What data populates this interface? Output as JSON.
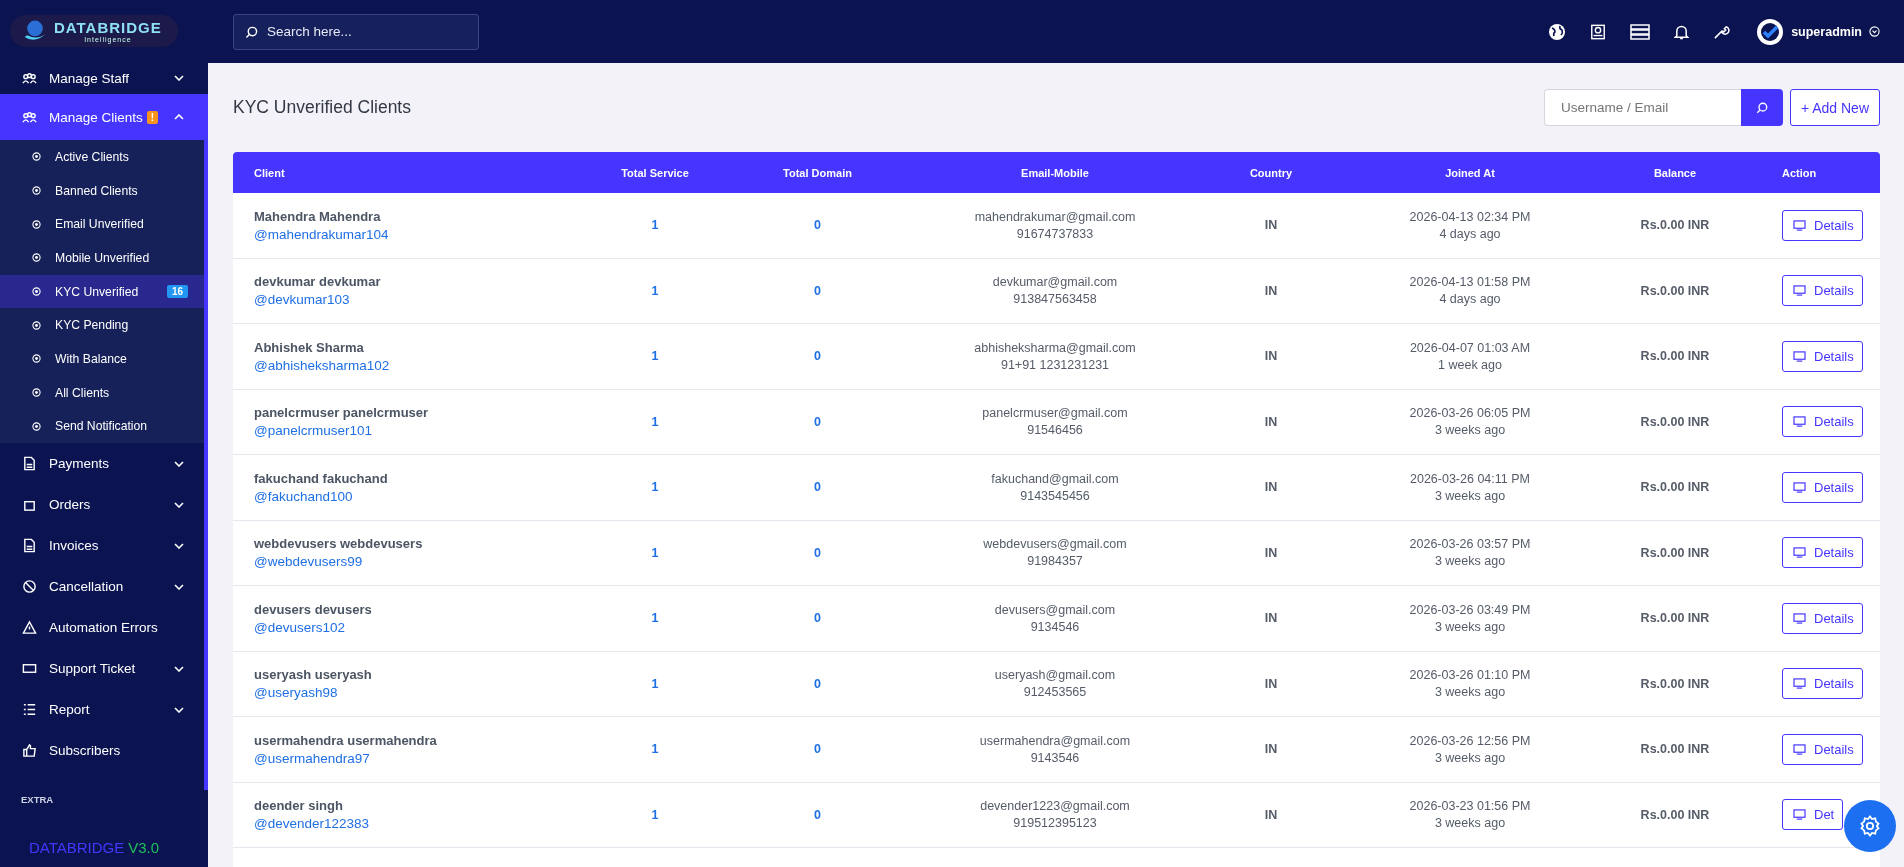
{
  "sidebar": {
    "logo": {
      "name": "DATABRIDGE",
      "tagline": "Intelligence"
    },
    "items": [
      {
        "label": "Manage Staff",
        "expandable": true,
        "expanded": false,
        "selected": false
      },
      {
        "label": "Manage Clients",
        "expandable": true,
        "expanded": true,
        "selected": true,
        "badge": "!",
        "children": [
          {
            "label": "Active Clients",
            "selected": false
          },
          {
            "label": "Banned Clients",
            "selected": false
          },
          {
            "label": "Email Unverified",
            "selected": false
          },
          {
            "label": "Mobile Unverified",
            "selected": false
          },
          {
            "label": "KYC Unverified",
            "selected": true,
            "badge": "16"
          },
          {
            "label": "KYC Pending",
            "selected": false
          },
          {
            "label": "With Balance",
            "selected": false
          },
          {
            "label": "All Clients",
            "selected": false
          },
          {
            "label": "Send Notification",
            "selected": false
          }
        ]
      },
      {
        "label": "Payments",
        "expandable": true,
        "expanded": false,
        "selected": false
      },
      {
        "label": "Orders",
        "expandable": true,
        "expanded": false,
        "selected": false
      },
      {
        "label": "Invoices",
        "expandable": true,
        "expanded": false,
        "selected": false
      },
      {
        "label": "Cancellation",
        "expandable": true,
        "expanded": false,
        "selected": false
      },
      {
        "label": "Automation Errors",
        "expandable": false,
        "selected": false
      },
      {
        "label": "Support Ticket",
        "expandable": true,
        "expanded": false,
        "selected": false
      },
      {
        "label": "Report",
        "expandable": true,
        "expanded": false,
        "selected": false
      },
      {
        "label": "Subscribers",
        "expandable": false,
        "selected": false
      }
    ],
    "section": "EXTRA",
    "footer": {
      "brand": "DATABRIDGE",
      "version": "V3.0"
    }
  },
  "topbar": {
    "search": {
      "placeholder": "Search here..."
    },
    "user": "superadmin"
  },
  "page": {
    "title": "KYC Unverified Clients",
    "search": {
      "placeholder": "Username / Email"
    },
    "add_button": "+ Add New"
  },
  "table": {
    "columns": [
      "Client",
      "Total Service",
      "Total Domain",
      "Email-Mobile",
      "Country",
      "Joined At",
      "Balance",
      "Action"
    ],
    "rows": [
      {
        "name": "Mahendra Mahendra",
        "username": "@mahendrakumar104",
        "services": "1",
        "domains": "0",
        "email": "mahendrakumar@gmail.com",
        "mobile": "91674737833",
        "country": "IN",
        "joined": "2026-04-13 02:34 PM",
        "ago": "4 days ago",
        "balance": "Rs.0.00 INR",
        "action": "Details"
      },
      {
        "name": "devkumar devkumar",
        "username": "@devkumar103",
        "services": "1",
        "domains": "0",
        "email": "devkumar@gmail.com",
        "mobile": "913847563458",
        "country": "IN",
        "joined": "2026-04-13 01:58 PM",
        "ago": "4 days ago",
        "balance": "Rs.0.00 INR",
        "action": "Details"
      },
      {
        "name": "Abhishek Sharma",
        "username": "@abhisheksharma102",
        "services": "1",
        "domains": "0",
        "email": "abhisheksharma@gmail.com",
        "mobile": "91+91 1231231231",
        "country": "IN",
        "joined": "2026-04-07 01:03 AM",
        "ago": "1 week ago",
        "balance": "Rs.0.00 INR",
        "action": "Details"
      },
      {
        "name": "panelcrmuser panelcrmuser",
        "username": "@panelcrmuser101",
        "services": "1",
        "domains": "0",
        "email": "panelcrmuser@gmail.com",
        "mobile": "91546456",
        "country": "IN",
        "joined": "2026-03-26 06:05 PM",
        "ago": "3 weeks ago",
        "balance": "Rs.0.00 INR",
        "action": "Details"
      },
      {
        "name": "fakuchand fakuchand",
        "username": "@fakuchand100",
        "services": "1",
        "domains": "0",
        "email": "fakuchand@gmail.com",
        "mobile": "9143545456",
        "country": "IN",
        "joined": "2026-03-26 04:11 PM",
        "ago": "3 weeks ago",
        "balance": "Rs.0.00 INR",
        "action": "Details"
      },
      {
        "name": "webdevusers webdevusers",
        "username": "@webdevusers99",
        "services": "1",
        "domains": "0",
        "email": "webdevusers@gmail.com",
        "mobile": "91984357",
        "country": "IN",
        "joined": "2026-03-26 03:57 PM",
        "ago": "3 weeks ago",
        "balance": "Rs.0.00 INR",
        "action": "Details"
      },
      {
        "name": "devusers devusers",
        "username": "@devusers102",
        "services": "1",
        "domains": "0",
        "email": "devusers@gmail.com",
        "mobile": "9134546",
        "country": "IN",
        "joined": "2026-03-26 03:49 PM",
        "ago": "3 weeks ago",
        "balance": "Rs.0.00 INR",
        "action": "Details"
      },
      {
        "name": "useryash useryash",
        "username": "@useryash98",
        "services": "1",
        "domains": "0",
        "email": "useryash@gmail.com",
        "mobile": "912453565",
        "country": "IN",
        "joined": "2026-03-26 01:10 PM",
        "ago": "3 weeks ago",
        "balance": "Rs.0.00 INR",
        "action": "Details"
      },
      {
        "name": "usermahendra usermahendra",
        "username": "@usermahendra97",
        "services": "1",
        "domains": "0",
        "email": "usermahendra@gmail.com",
        "mobile": "9143546",
        "country": "IN",
        "joined": "2026-03-26 12:56 PM",
        "ago": "3 weeks ago",
        "balance": "Rs.0.00 INR",
        "action": "Details"
      },
      {
        "name": "deender singh",
        "username": "@devender122383",
        "services": "1",
        "domains": "0",
        "email": "devender1223@gmail.com",
        "mobile": "919512395123",
        "country": "IN",
        "joined": "2026-03-23 01:56 PM",
        "ago": "3 weeks ago",
        "balance": "Rs.0.00 INR",
        "action": "Det"
      }
    ]
  }
}
